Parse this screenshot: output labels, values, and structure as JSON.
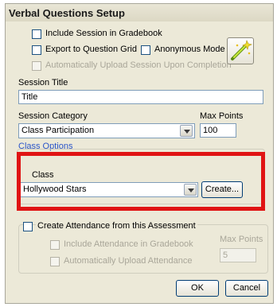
{
  "window": {
    "title": "Verbal Questions Setup"
  },
  "options": {
    "include_gradebook": "Include Session in Gradebook",
    "export_grid": "Export to Question Grid",
    "anonymous_mode": "Anonymous Mode",
    "auto_upload": "Automatically Upload Session Upon Completion"
  },
  "session_title": {
    "label": "Session Title",
    "value": "Title"
  },
  "session_category": {
    "label": "Session Category",
    "value": "Class Participation"
  },
  "max_points": {
    "label": "Max Points",
    "value": "100"
  },
  "class_options": {
    "header": "Class Options",
    "class_label": "Class",
    "class_value": "Hollywood Stars",
    "create_button": "Create..."
  },
  "attendance": {
    "create_label": "Create Attendance from this Assessment",
    "include_label": "Include Attendance in Gradebook",
    "auto_upload_label": "Automatically Upload Attendance",
    "max_points_label": "Max Points",
    "max_points_value": "5"
  },
  "buttons": {
    "ok": "OK",
    "cancel": "Cancel"
  },
  "colors": {
    "highlight": "#e01414",
    "link_blue": "#2a55c9"
  },
  "icons": {
    "wizard": "magic-wand-icon"
  }
}
